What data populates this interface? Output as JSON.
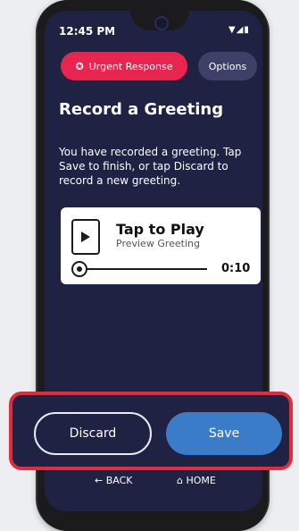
{
  "status": {
    "time": "12:45 PM",
    "icons": "▼◢▮"
  },
  "header": {
    "urgent_label": "Urgent Response",
    "options_label": "Options"
  },
  "page": {
    "title": "Record a Greeting",
    "description": "You have recorded a greeting. Tap Save to finish, or tap Discard to record a new greeting."
  },
  "player": {
    "title": "Tap to Play",
    "subtitle": "Preview Greeting",
    "duration": "0:10",
    "progress": 0
  },
  "actions": {
    "discard_label": "Discard",
    "save_label": "Save"
  },
  "nav": {
    "back_label": "BACK",
    "home_label": "HOME"
  },
  "colors": {
    "accent": "#e8254f",
    "save": "#3a7cc7",
    "bg": "#1f2243",
    "highlight": "#e62a3c"
  }
}
